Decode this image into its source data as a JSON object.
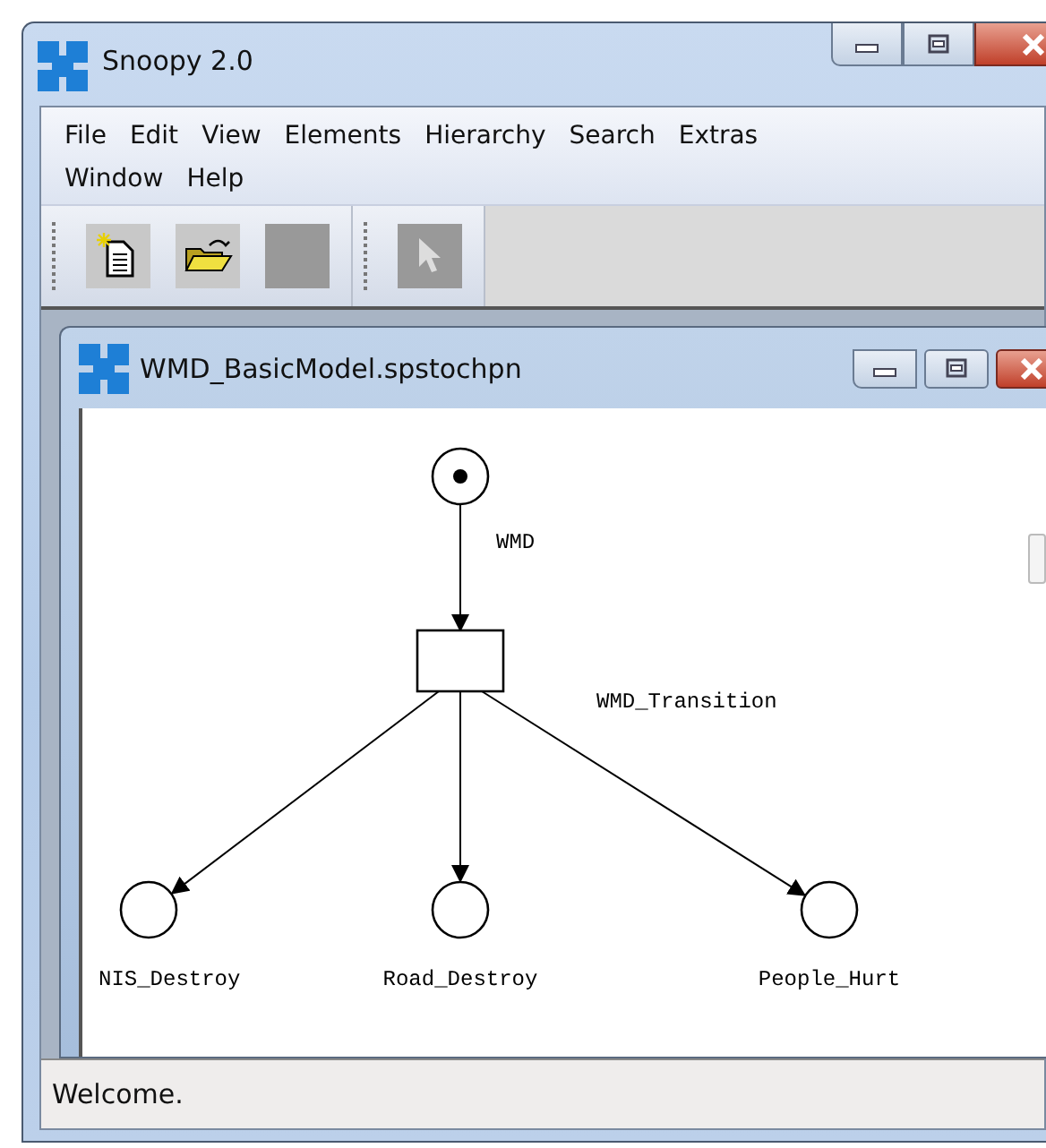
{
  "window": {
    "title": "Snoopy 2.0"
  },
  "menu": [
    {
      "label": "File"
    },
    {
      "label": "Edit"
    },
    {
      "label": "View"
    },
    {
      "label": "Elements"
    },
    {
      "label": "Hierarchy"
    },
    {
      "label": "Search"
    },
    {
      "label": "Extras"
    },
    {
      "label": "Window"
    },
    {
      "label": "Help"
    }
  ],
  "toolbar": [
    {
      "kind": "new",
      "disabled": false
    },
    {
      "kind": "open",
      "disabled": false
    },
    {
      "kind": "blank",
      "disabled": true
    },
    {
      "kind": "separator"
    },
    {
      "kind": "pointer",
      "disabled": true
    }
  ],
  "child_window": {
    "title": "WMD_BasicModel.spstochpn"
  },
  "diagram": {
    "places": [
      {
        "label": "WMD",
        "marked": true
      },
      {
        "label": "NIS_Destroy",
        "marked": false
      },
      {
        "label": "Road_Destroy",
        "marked": false
      },
      {
        "label": "People_Hurt",
        "marked": false
      }
    ],
    "transitions": [
      {
        "label": "WMD_Transition"
      }
    ]
  },
  "status_bar": {
    "text": "Welcome."
  }
}
